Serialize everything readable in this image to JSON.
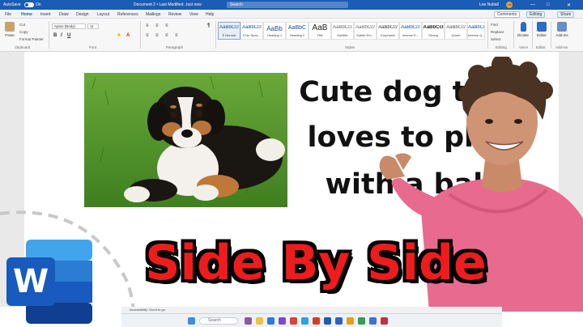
{
  "titlebar": {
    "autosave_label": "AutoSave",
    "toggle_state": "On",
    "doc_title": "Document 2 • Last Modified: Just now",
    "search_placeholder": "Search",
    "user_name": "Lee Nuttall",
    "user_initials": "LN"
  },
  "menu": {
    "tabs": [
      "File",
      "Home",
      "Insert",
      "Draw",
      "Design",
      "Layout",
      "References",
      "Mailings",
      "Review",
      "View",
      "Help"
    ],
    "active_tab": "Home",
    "comments_label": "Comments",
    "editing_label": "Editing",
    "share_label": "Share"
  },
  "ribbon": {
    "clipboard": {
      "paste": "Paste",
      "cut": "Cut",
      "copy": "Copy",
      "format_painter": "Format Painter",
      "label": "Clipboard"
    },
    "font": {
      "font_name": "Aptos (Body)",
      "font_size": "11",
      "bold": "B",
      "italic": "I",
      "underline": "U",
      "label": "Font"
    },
    "paragraph": {
      "label": "Paragraph"
    },
    "styles": {
      "items": [
        {
          "sample": "AaBbCcI",
          "name": "¶ Normal"
        },
        {
          "sample": "AaBbCcI",
          "name": "¶ No Spac..."
        },
        {
          "sample": "AaBb",
          "name": "Heading 1"
        },
        {
          "sample": "AaBbC",
          "name": "Heading 2"
        },
        {
          "sample": "AaB",
          "name": "Title"
        },
        {
          "sample": "AaBbCcI",
          "name": "Subtitle"
        },
        {
          "sample": "AaBbCcI",
          "name": "Subtle Em..."
        },
        {
          "sample": "AaBbCcI",
          "name": "Emphasis"
        },
        {
          "sample": "AaBbCcI",
          "name": "Intense E..."
        },
        {
          "sample": "AaBbCcI",
          "name": "Strong"
        },
        {
          "sample": "AaBbCcI",
          "name": "Quote"
        },
        {
          "sample": "AaBbCcI",
          "name": "Intense Q..."
        }
      ],
      "label": "Styles"
    },
    "editing": {
      "find": "Find",
      "replace": "Replace",
      "select": "Select",
      "label": "Editing"
    },
    "voice": {
      "dictate": "Dictate",
      "label": "Voice"
    },
    "editor": {
      "editor": "Editor",
      "label": "Editor"
    },
    "addins": {
      "addins": "Add-ins",
      "label": "Add-ins"
    }
  },
  "document": {
    "lines": [
      "Cute dog that",
      "loves to play",
      "with a ball"
    ]
  },
  "overlay": {
    "headline": "Side By Side",
    "logo_letter": "W"
  },
  "statusbar": {
    "accessibility": "Accessibility: Good to go"
  },
  "taskbar": {
    "search_placeholder": "Search"
  },
  "colors": {
    "word_blue": "#1b5cb4",
    "headline_red": "#ee1c1c",
    "headline_outline": "#000000"
  }
}
